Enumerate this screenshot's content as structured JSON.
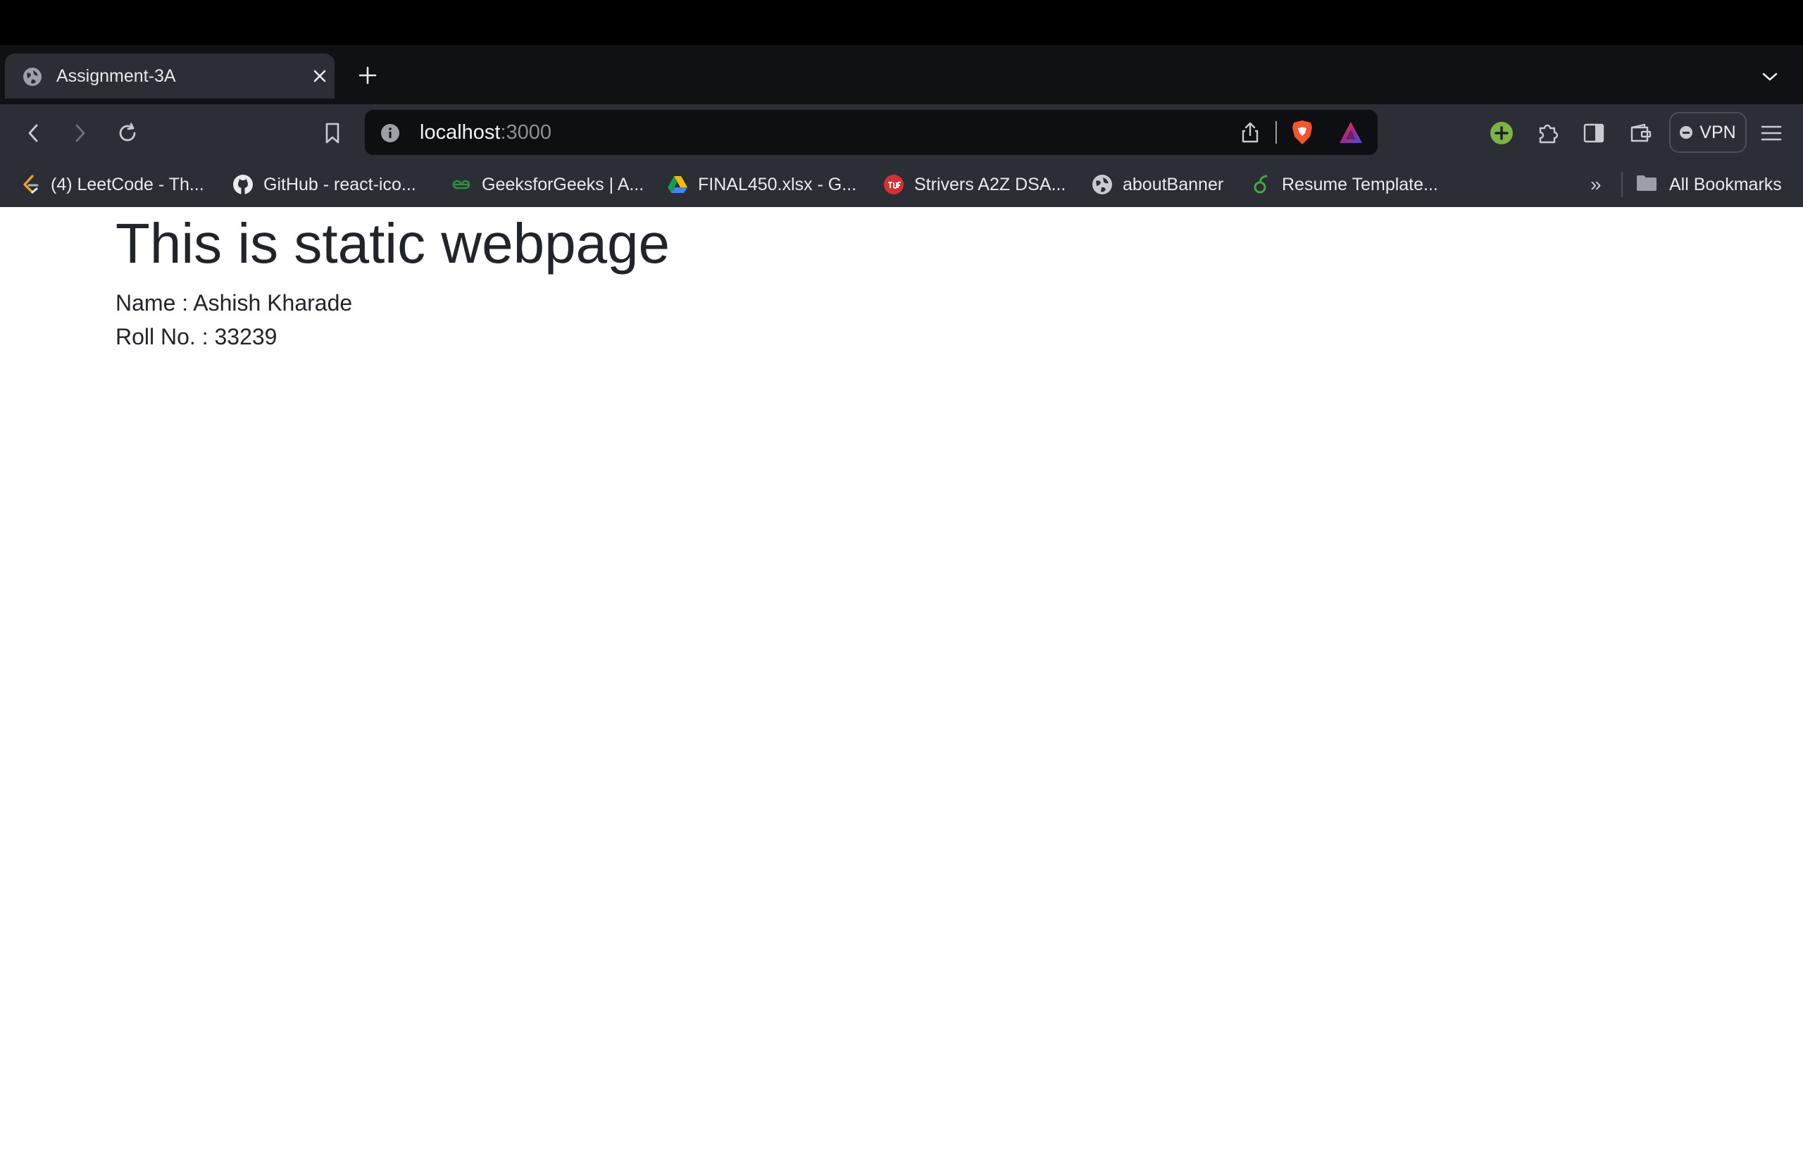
{
  "browser": {
    "tab": {
      "title": "Assignment-3A"
    },
    "address_bar": {
      "host": "localhost",
      "port": ":3000"
    },
    "vpn_label": "VPN",
    "bookmarks": [
      {
        "label": "(4) LeetCode - Th...",
        "icon": "leetcode-icon"
      },
      {
        "label": "GitHub - react-ico...",
        "icon": "github-icon"
      },
      {
        "label": "GeeksforGeeks | A...",
        "icon": "geeksforgeeks-icon"
      },
      {
        "label": "FINAL450.xlsx - G...",
        "icon": "google-drive-icon"
      },
      {
        "label": "Strivers A2Z DSA...",
        "icon": "tuf-icon"
      },
      {
        "label": "aboutBanner",
        "icon": "globe-icon"
      },
      {
        "label": "Resume Template...",
        "icon": "overleaf-icon"
      }
    ],
    "overflow_label": "»",
    "all_bookmarks_label": "All Bookmarks"
  },
  "page": {
    "heading": "This is static webpage",
    "name_line": "Name : Ashish Kharade",
    "roll_line": "Roll No. : 33239"
  },
  "colors": {
    "tab_active": "#2b2f35",
    "toolbar": "#2b2f35",
    "omnibox": "#0d0f12",
    "page_text": "#212529",
    "brave_orange": "#fb542b"
  }
}
